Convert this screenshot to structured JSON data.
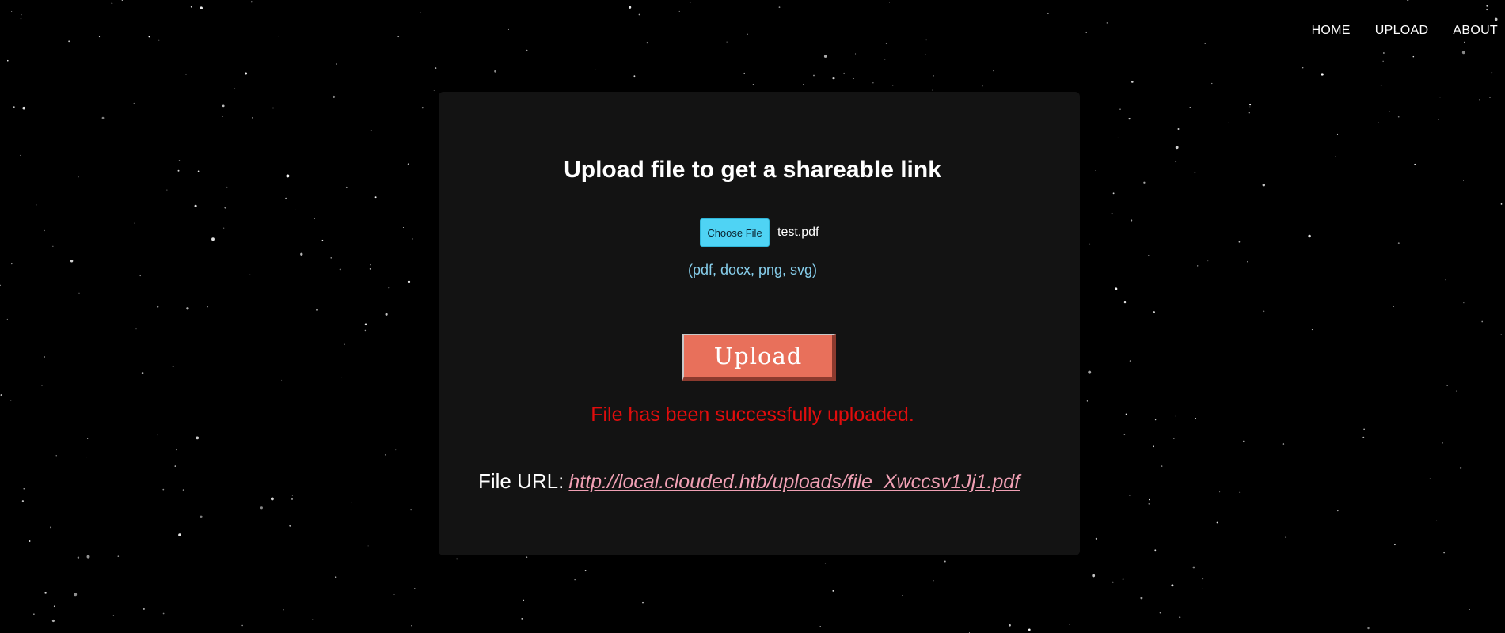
{
  "nav": {
    "items": [
      {
        "label": "HOME"
      },
      {
        "label": "UPLOAD"
      },
      {
        "label": "ABOUT"
      }
    ]
  },
  "upload_card": {
    "title": "Upload file to get a shareable link",
    "choose_file_label": "Choose File",
    "selected_file": "test.pdf",
    "allowed_formats": "(pdf, docx, png, svg)",
    "upload_button_label": "Upload",
    "status_message": "File has been successfully uploaded.",
    "file_url_label": "File URL:",
    "file_url": "http://local.clouded.htb/uploads/file_Xwccsv1Jj1.pdf"
  },
  "colors": {
    "background": "#000000",
    "card_background": "#131313",
    "choose_button": "#4fd3f4",
    "formats_text": "#87ceeb",
    "upload_button": "#e8705b",
    "success_text": "#e00d0d",
    "url_link": "#f0a0b4"
  }
}
